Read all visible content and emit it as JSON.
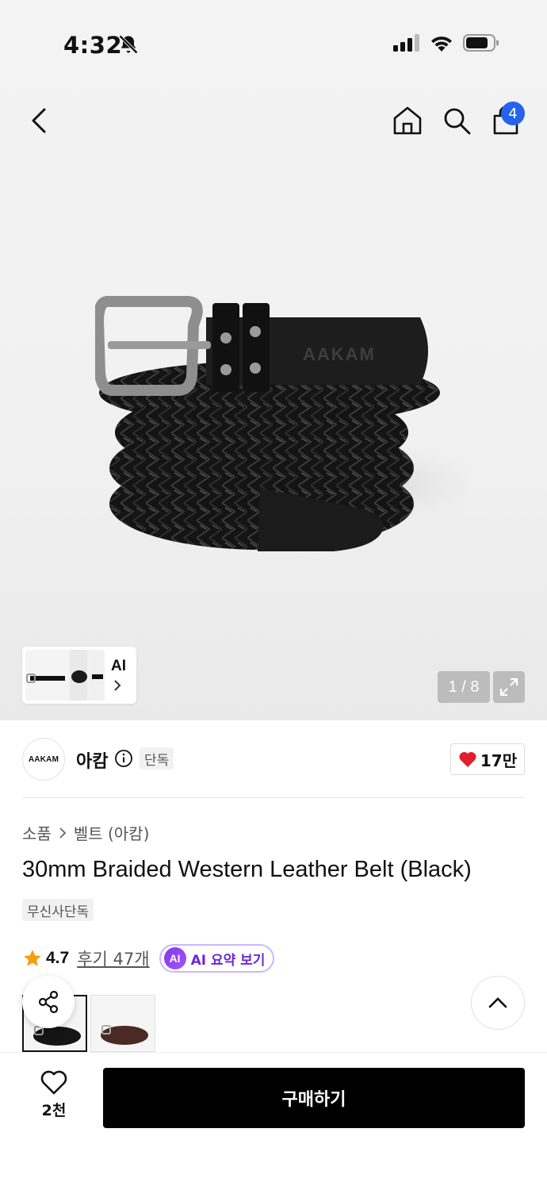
{
  "status_bar": {
    "time": "4:32",
    "icons": [
      "bell-slash-icon",
      "signal-icon",
      "wifi-icon",
      "battery-icon"
    ]
  },
  "nav": {
    "icons": [
      "back-chevron-icon",
      "home-icon",
      "search-icon",
      "bag-icon"
    ],
    "cart_count": "4"
  },
  "gallery": {
    "thumb_label": "AI",
    "page_indicator": "1 / 8",
    "product_logo_text": "AAKAM"
  },
  "brand": {
    "logo_text": "AAKAM",
    "name": "아캄",
    "tag": "단독",
    "likes": "17만"
  },
  "product": {
    "breadcrumb": [
      "소품",
      "벨트 (아캄)"
    ],
    "title": "30mm Braided Western Leather Belt (Black)",
    "tag": "무신사단독",
    "rating": "4.7",
    "reviews": "후기 47개",
    "ai_badge": "AI",
    "ai_summary": "AI 요약 보기"
  },
  "bottom": {
    "wish_count": "2천",
    "buy_label": "구매하기"
  },
  "colors": {
    "accent_blue": "#2563eb",
    "ai_purple": "#6d28d9",
    "heart_red": "#e11d2e",
    "star_orange": "#f59e0b"
  }
}
